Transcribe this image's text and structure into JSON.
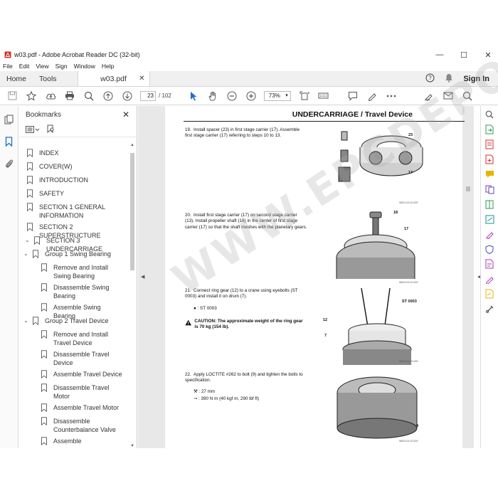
{
  "window": {
    "title": "w03.pdf - Adobe Acrobat Reader DC (32-bit)"
  },
  "menu": [
    "File",
    "Edit",
    "View",
    "Sign",
    "Window",
    "Help"
  ],
  "tabs": {
    "home": "Home",
    "tools": "Tools",
    "document": "w03.pdf"
  },
  "header": {
    "signin": "Sign In"
  },
  "toolbar": {
    "page_current": "23",
    "page_total": "/ 102",
    "zoom": "73%"
  },
  "bookmarks": {
    "title": "Bookmarks",
    "items": [
      "INDEX",
      "COVER(W)",
      "INTRODUCTION",
      "SAFETY",
      "SECTION 1 GENERAL INFORMATION",
      "SECTION 2 SUPERSTRUCTURE",
      "SECTION 3 UNDERCARRIAGE",
      "Group 1 Swing Bearing",
      "Remove and Install Swing Bearing",
      "Disassemble Swing Bearing",
      "Assemble Swing Bearing",
      "Group 2 Travel Device",
      "Remove and Install Travel Device",
      "Disassemble Travel Device",
      "Assemble Travel Device",
      "Disassemble Travel Motor",
      "Assemble Travel Motor",
      "Disassemble Counterbalance Valve",
      "Assemble"
    ]
  },
  "document": {
    "heading": "UNDERCARRIAGE / Travel Device",
    "steps": [
      {
        "num": "19.",
        "text": "Install spacer (23) in first stage carrier (17). Assemble first stage carrier (17) referring to steps 10 to 13."
      },
      {
        "num": "20.",
        "text": "Install first stage carrier (17) on second stage carrier (13). Install propeller shaft (18) in the center of first stage carrier (17) so that the shaft meshes with the planetary gears."
      },
      {
        "num": "21.",
        "text": "Connect ring gear (12) to a crane using eyebolts (ST 0003) and install it on drum (7)."
      },
      {
        "num": "22.",
        "text": "Apply LOCTITE #262 to bolt (9) and tighten the bolts to specification."
      }
    ],
    "tool_note": ": ST 0003",
    "caution": "CAUTION: The approximate weight of the ring gear is 70 kg (154 lb).",
    "wrench": ": 27 mm",
    "torque": ": 390 N m (40 kgf m, 290 lbf ft)",
    "figure_codes": [
      "W524-03-02-009",
      "W524-03-02-009",
      "W524-03-02-009",
      "W524-03-02-009"
    ],
    "callouts": [
      "23",
      "17",
      "18",
      "17",
      "ST 0003",
      "12",
      "7",
      "9"
    ]
  },
  "watermark": "WWW.EPCDEPO.COM",
  "colors": {
    "acrobat_red": "#d4312b",
    "accent_blue": "#1a6fc9",
    "panel_bg": "#f0f0f0"
  }
}
